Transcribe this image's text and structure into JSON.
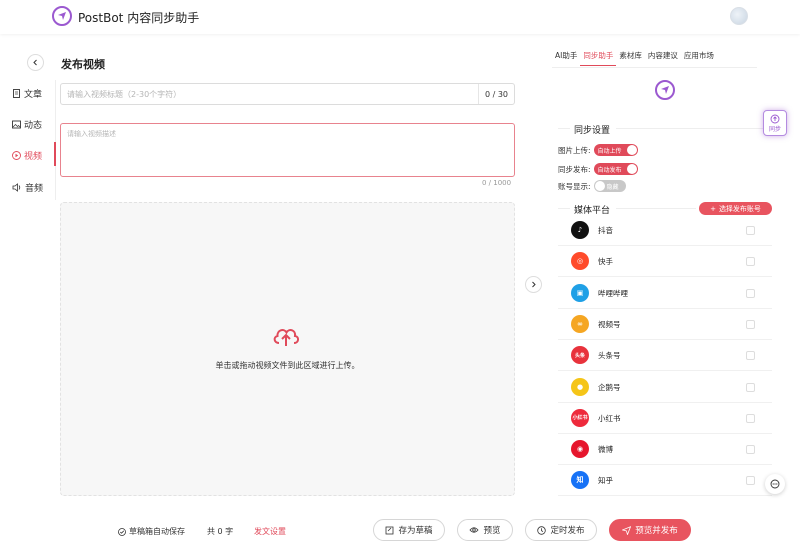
{
  "header": {
    "app_title": "PostBot 内容同步助手"
  },
  "nav": {
    "items": [
      {
        "label": "文章",
        "icon": "document-icon"
      },
      {
        "label": "动态",
        "icon": "image-icon"
      },
      {
        "label": "视频",
        "icon": "play-icon",
        "active": true
      },
      {
        "label": "音频",
        "icon": "speaker-icon"
      }
    ]
  },
  "main": {
    "page_title": "发布视频",
    "title_placeholder": "请输入视频标题（2-30个字符）",
    "title_count": "0 / 30",
    "desc_placeholder": "请输入视频描述",
    "desc_count": "0 / 1000",
    "upload_text": "单击或拖动视频文件到此区域进行上传。"
  },
  "panel": {
    "tabs": [
      "AI助手",
      "同步助手",
      "素材库",
      "内容建议",
      "应用市场"
    ],
    "active_tab": "同步助手",
    "sync_settings_title": "同步设置",
    "settings": [
      {
        "label": "图片上传:",
        "toggle_text": "自动上传",
        "on": true
      },
      {
        "label": "同步发布:",
        "toggle_text": "自动发布",
        "on": true
      },
      {
        "label": "账号显示:",
        "toggle_text": "隐藏",
        "on": false
      }
    ],
    "media_title": "媒体平台",
    "add_account_label": "选择发布账号",
    "platforms": [
      {
        "name": "抖音",
        "icon": "douyin-icon",
        "color": "#111111",
        "glyph": "♪"
      },
      {
        "name": "快手",
        "icon": "kuaishou-icon",
        "color": "#ff4b2b",
        "glyph": "◎"
      },
      {
        "name": "哔哩哔哩",
        "icon": "bilibili-icon",
        "color": "#1fa0e6",
        "glyph": "▣"
      },
      {
        "name": "视频号",
        "icon": "channels-icon",
        "color": "#f5a623",
        "glyph": "∞"
      },
      {
        "name": "头条号",
        "icon": "toutiao-icon",
        "color": "#e8323c",
        "glyph": "头条"
      },
      {
        "name": "企鹅号",
        "icon": "penguin-icon",
        "color": "#f5c518",
        "glyph": "●"
      },
      {
        "name": "小红书",
        "icon": "xiaohongshu-icon",
        "color": "#ee2a3c",
        "glyph": "小红书"
      },
      {
        "name": "微博",
        "icon": "weibo-icon",
        "color": "#e6162d",
        "glyph": "◉"
      },
      {
        "name": "知乎",
        "icon": "zhihu-icon",
        "color": "#1772f6",
        "glyph": "知"
      }
    ],
    "sync_float_label": "同步"
  },
  "footer": {
    "autosave": "草稿箱自动保存",
    "word_count": "共 0 字",
    "settings_link": "发文设置",
    "save_draft": "存为草稿",
    "preview": "预览",
    "schedule": "定时发布",
    "publish": "预览并发布"
  },
  "colors": {
    "accent": "#e04a5a",
    "brand": "#9b59d0"
  }
}
